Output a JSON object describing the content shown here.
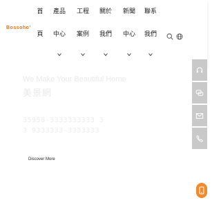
{
  "brand": {
    "logo_text": "Bossoho'",
    "accent_color": "#e8731a"
  },
  "nav": {
    "items": [
      {
        "line1": "首",
        "line2": "頁",
        "has_dropdown": false
      },
      {
        "line1": "產品",
        "line2": "中心",
        "has_dropdown": true
      },
      {
        "line1": "工程",
        "line2": "案例",
        "has_dropdown": true
      },
      {
        "line1": "關於",
        "line2": "我們",
        "has_dropdown": true
      },
      {
        "line1": "新聞",
        "line2": "中心",
        "has_dropdown": true
      },
      {
        "line1": "聯系",
        "line2": "我們",
        "has_dropdown": true
      }
    ],
    "search_icon": "search-icon",
    "language_icon": "globe-icon"
  },
  "hero": {
    "tagline": "We Make Your Beautiful Home",
    "title": "美景網",
    "description": "35958-3333333333 3 3 9333333-3333333",
    "cta_label": "Discover More"
  },
  "side_toolbar": {
    "button_color": "#c9c9c9",
    "buttons": [
      {
        "icon": "headset-icon"
      },
      {
        "icon": "chat-icon"
      },
      {
        "icon": "mail-icon"
      },
      {
        "icon": "phone-icon"
      }
    ]
  },
  "floating_button": {
    "icon": "phone-icon",
    "color": "#f08a2c"
  }
}
